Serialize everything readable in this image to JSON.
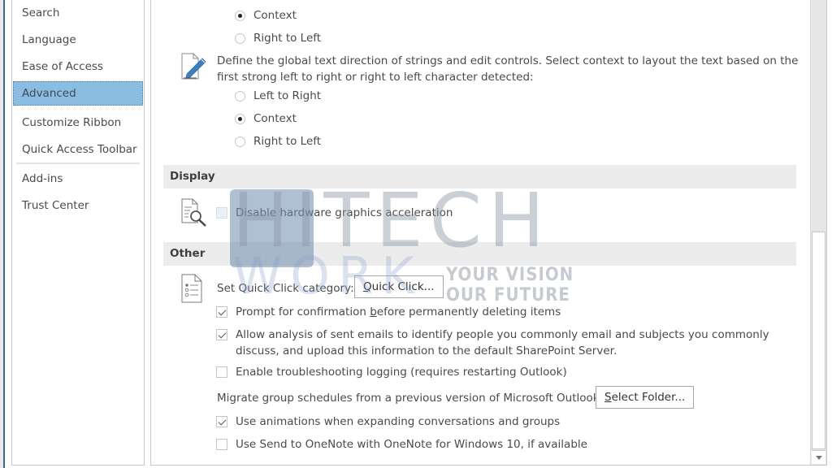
{
  "sidebar": {
    "items": [
      {
        "label": "Search",
        "selected": false
      },
      {
        "label": "Language",
        "selected": false
      },
      {
        "label": "Ease of Access",
        "selected": false
      },
      {
        "label": "Advanced",
        "selected": true
      },
      {
        "label": "Customize Ribbon",
        "selected": false
      },
      {
        "label": "Quick Access Toolbar",
        "selected": false
      },
      {
        "label": "Add-ins",
        "selected": false
      },
      {
        "label": "Trust Center",
        "selected": false
      }
    ]
  },
  "main": {
    "top_radio_group": [
      {
        "label": "Context",
        "checked": true
      },
      {
        "label": "Right to Left",
        "checked": false
      }
    ],
    "text_direction": {
      "icon": "edit-document-icon",
      "description": "Define the global text direction of strings and edit controls. Select context to layout the text based on the first strong left to right or right to left character detected:",
      "options": [
        {
          "label": "Left to Right",
          "checked": false
        },
        {
          "label": "Context",
          "checked": true
        },
        {
          "label": "Right to Left",
          "checked": false
        }
      ]
    },
    "display": {
      "header": "Display",
      "icon": "document-search-icon",
      "options": [
        {
          "label": "Disable hardware graphics acceleration",
          "checked": false
        }
      ]
    },
    "other": {
      "header": "Other",
      "icon": "list-document-icon",
      "quick_click_label": "Set Quick Click category:",
      "quick_click_button": "Quick Click...",
      "options": [
        {
          "label": "Prompt for confirmation before permanently deleting items",
          "checked": true
        },
        {
          "label": "Allow analysis of sent emails to identify people you commonly email and subjects you commonly discuss, and upload this information to the default SharePoint Server.",
          "checked": true
        },
        {
          "label": "Enable troubleshooting logging (requires restarting Outlook)",
          "checked": false
        }
      ],
      "migrate_label": "Migrate group schedules from a previous version of Microsoft Outlook:",
      "select_folder_button": "Select Folder...",
      "options_after": [
        {
          "label": "Use animations when expanding conversations and groups",
          "checked": true
        },
        {
          "label": "Use Send to OneNote with OneNote for Windows 10, if available",
          "checked": false
        }
      ]
    }
  },
  "watermark": {
    "brand_top": "HITECH",
    "brand_bottom": "WORK",
    "slogan_line1": "YOUR VISION",
    "slogan_line2": "OUR FUTURE"
  }
}
